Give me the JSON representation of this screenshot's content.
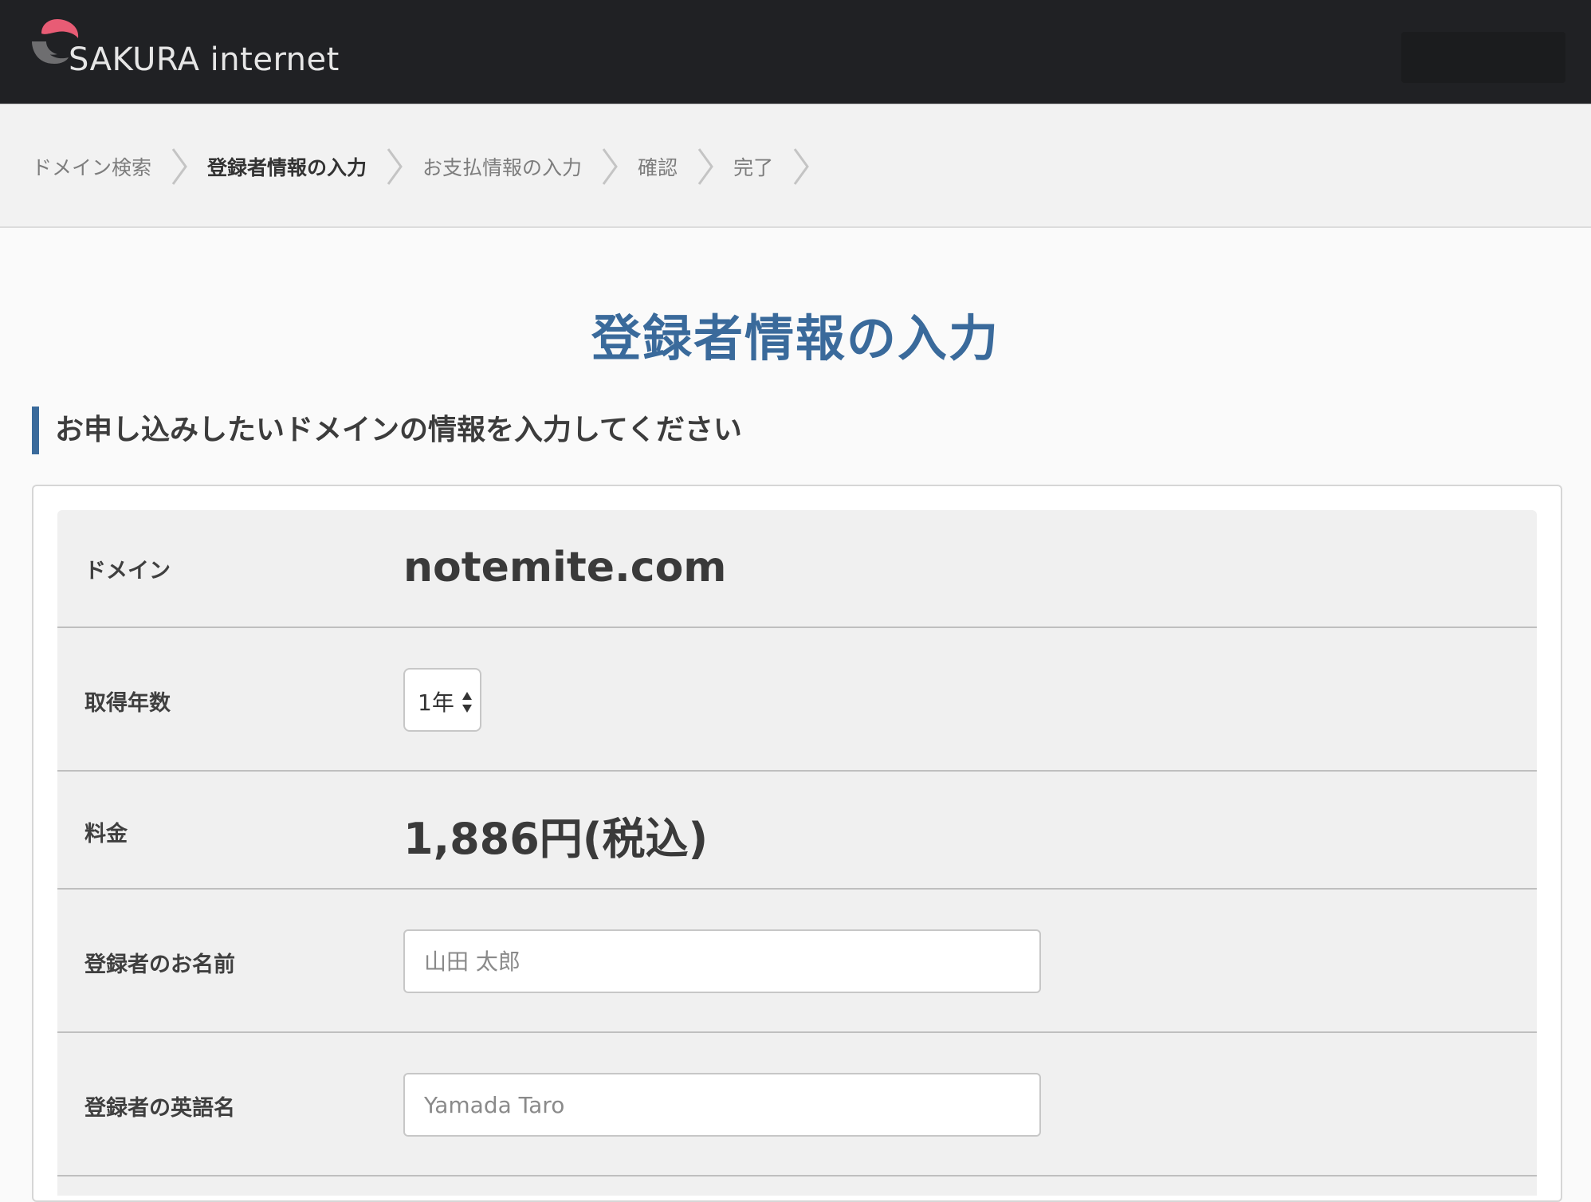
{
  "header": {
    "logo_text": "SAKURA internet",
    "colors": {
      "bar": "#202124",
      "logo_pink": "#e85c75",
      "logo_gray": "#6e6e70"
    }
  },
  "breadcrumb": [
    {
      "label": "ドメイン検索",
      "active": false
    },
    {
      "label": "登録者情報の入力",
      "active": true
    },
    {
      "label": "お支払情報の入力",
      "active": false
    },
    {
      "label": "確認",
      "active": false
    },
    {
      "label": "完了",
      "active": false
    }
  ],
  "page": {
    "title": "登録者情報の入力",
    "section_heading": "お申し込みしたいドメインの情報を入力してください",
    "accent_color": "#3a6a9b"
  },
  "form": {
    "domain": {
      "label": "ドメイン",
      "value": "notemite.com"
    },
    "years": {
      "label": "取得年数",
      "selected": "1年"
    },
    "price": {
      "label": "料金",
      "value": "1,886円(税込)"
    },
    "name": {
      "label": "登録者のお名前",
      "placeholder": "山田 太郎"
    },
    "english_name": {
      "label": "登録者の英語名",
      "placeholder": "Yamada Taro"
    }
  }
}
